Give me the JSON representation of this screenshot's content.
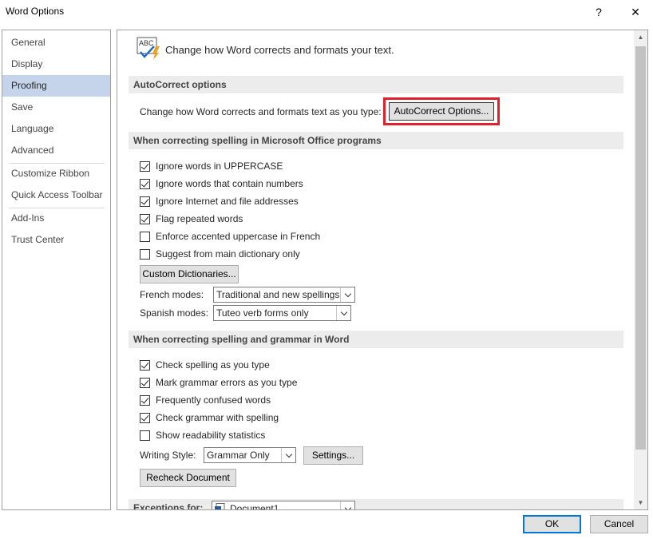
{
  "window": {
    "title": "Word Options",
    "help_glyph": "?",
    "close_glyph": "✕"
  },
  "sidebar": {
    "items": [
      {
        "label": "General"
      },
      {
        "label": "Display"
      },
      {
        "label": "Proofing",
        "selected": true
      },
      {
        "label": "Save"
      },
      {
        "label": "Language"
      },
      {
        "label": "Advanced"
      },
      {
        "label": "Customize Ribbon"
      },
      {
        "label": "Quick Access Toolbar"
      },
      {
        "label": "Add-Ins"
      },
      {
        "label": "Trust Center"
      }
    ]
  },
  "header": {
    "icon": "abc-check-icon",
    "icon_text": "ABC",
    "text": "Change how Word corrects and formats your text."
  },
  "autocorrect": {
    "section_title": "AutoCorrect options",
    "description": "Change how Word corrects and formats text as you type:",
    "button_label": "AutoCorrect Options..."
  },
  "office_spelling": {
    "section_title": "When correcting spelling in Microsoft Office programs",
    "options": [
      {
        "label": "Ignore words in UPPERCASE",
        "checked": true
      },
      {
        "label": "Ignore words that contain numbers",
        "checked": true
      },
      {
        "label": "Ignore Internet and file addresses",
        "checked": true
      },
      {
        "label": "Flag repeated words",
        "checked": true
      },
      {
        "label": "Enforce accented uppercase in French",
        "checked": false
      },
      {
        "label": "Suggest from main dictionary only",
        "checked": false
      }
    ],
    "custom_dictionaries_label": "Custom Dictionaries...",
    "french_modes_label": "French modes:",
    "french_modes_value": "Traditional and new spellings",
    "spanish_modes_label": "Spanish modes:",
    "spanish_modes_value": "Tuteo verb forms only"
  },
  "word_grammar": {
    "section_title": "When correcting spelling and grammar in Word",
    "options": [
      {
        "label": "Check spelling as you type",
        "checked": true
      },
      {
        "label": "Mark grammar errors as you type",
        "checked": true
      },
      {
        "label": "Frequently confused words",
        "checked": true
      },
      {
        "label": "Check grammar with spelling",
        "checked": true
      },
      {
        "label": "Show readability statistics",
        "checked": false
      }
    ],
    "writing_style_label": "Writing Style:",
    "writing_style_value": "Grammar Only",
    "settings_label": "Settings...",
    "recheck_label": "Recheck Document"
  },
  "exceptions": {
    "label": "Exceptions for:",
    "value": "Document1"
  },
  "footer": {
    "ok_label": "OK",
    "cancel_label": "Cancel"
  },
  "colors": {
    "selected_nav": "#c5d4ea",
    "highlight_box": "#e0202a",
    "ok_border": "#0078d7"
  }
}
